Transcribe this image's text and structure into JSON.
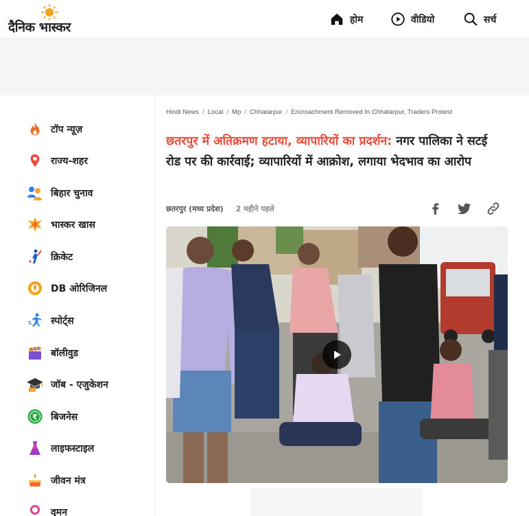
{
  "header": {
    "logo_text": "दैनिक भास्कर",
    "nav": [
      {
        "label": "होम",
        "icon": "home-icon"
      },
      {
        "label": "वीडियो",
        "icon": "play-circle-icon"
      },
      {
        "label": "सर्च",
        "icon": "search-icon"
      }
    ]
  },
  "sidebar": {
    "items": [
      {
        "label": "टॉप न्यूज़",
        "icon": "fire-icon"
      },
      {
        "label": "राज्य-शहर",
        "icon": "location-pin-icon"
      },
      {
        "label": "बिहार चुनाव",
        "icon": "election-icon"
      },
      {
        "label": "भास्कर खास",
        "icon": "star-burst-icon"
      },
      {
        "label": "क्रिकेट",
        "icon": "cricket-icon"
      },
      {
        "label": "DB ओरिजिनल",
        "icon": "db-original-icon"
      },
      {
        "label": "स्पोर्ट्स",
        "icon": "sports-runner-icon"
      },
      {
        "label": "बॉलीवुड",
        "icon": "clapperboard-icon"
      },
      {
        "label": "जॉब - एजुकेशन",
        "icon": "graduation-cap-icon"
      },
      {
        "label": "बिजनेस",
        "icon": "rupee-icon"
      },
      {
        "label": "लाइफस्टाइल",
        "icon": "dress-icon"
      },
      {
        "label": "जीवन मंत्र",
        "icon": "diya-icon"
      },
      {
        "label": "वुमन",
        "icon": "woman-icon"
      }
    ]
  },
  "article": {
    "breadcrumbs": [
      "Hindi News",
      "Local",
      "Mp",
      "Chhatarpur",
      "Encroachment Removed In Chhatarpur, Traders Protest"
    ],
    "headline_highlight": "छतरपुर में अतिक्रमण हटाया, व्यापारियों का प्रदर्शन:",
    "headline_rest": " नगर पालिका ने सटई रोड पर की कार्रवाई; व्यापारियों में आक्रोश, लगाया भेदभाव का आरोप",
    "location": "छतरपुर (मध्य प्रदेश)",
    "time": "2 महीने पहले",
    "share_icons": [
      "facebook-icon",
      "twitter-icon",
      "link-icon"
    ]
  },
  "colors": {
    "accent_red": "#e74c3c",
    "logo_sun": "#f7a21b"
  }
}
